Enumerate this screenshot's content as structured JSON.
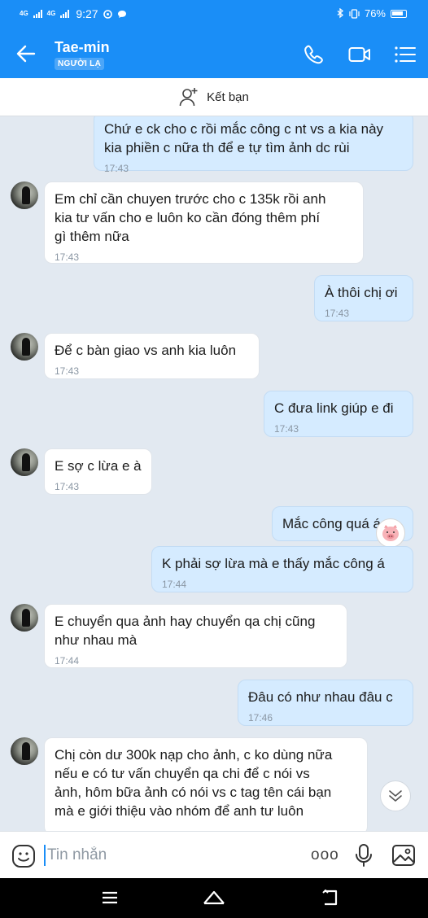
{
  "status_bar": {
    "net1": "4G",
    "net2": "4G",
    "time": "9:27",
    "battery": "76%"
  },
  "header": {
    "title": "Tae-min",
    "badge": "NGƯỜI LẠ",
    "accent": "#1a8ef7"
  },
  "friend_bar": {
    "label": "Kết bạn",
    "icon": "add-friend-icon"
  },
  "messages": [
    {
      "dir": "out",
      "text": "Chứ e ck cho c rồi mắc công c nt vs a kia này\nkia phiền c nữa th để e  tự tìm ảnh dc rùi",
      "time": "17:43"
    },
    {
      "dir": "in",
      "text": "Em chỉ cần chuyen trước cho c 135k rồi anh\nkia tư vấn cho e luôn ko cần đóng thêm phí\ngì thêm nữa",
      "time": "17:43"
    },
    {
      "dir": "out",
      "text": "À thôi chị ơi",
      "time": "17:43"
    },
    {
      "dir": "in",
      "text": "Để c bàn giao vs anh kia luôn",
      "time": "17:43"
    },
    {
      "dir": "out",
      "text": "C đưa link giúp e đi",
      "time": "17:43"
    },
    {
      "dir": "in",
      "text": "E sợ c lừa e à",
      "time": "17:43"
    },
    {
      "dir": "out",
      "text": "Mắc công quá á",
      "time": ""
    },
    {
      "dir": "out",
      "text": "K phải sợ lừa mà e thấy mắc công á",
      "time": "17:44"
    },
    {
      "dir": "in",
      "text": "E chuyển qua ảnh hay chuyển qa chị cũng\nnhư nhau mà",
      "time": "17:44"
    },
    {
      "dir": "out",
      "text": "Đâu có như nhau đâu c",
      "time": "17:46"
    },
    {
      "dir": "in",
      "text": "Chị còn dư 300k nạp cho ảnh, c ko dùng nữa\nnếu e có tư vấn chuyển qa chi để c nói vs\nảnh, hôm bữa ảnh có nói vs c tag tên cái bạn\nmà e giới thiệu vào nhóm để anh tư luôn",
      "time": ""
    }
  ],
  "composer": {
    "placeholder": "Tin nhắn",
    "more": "ooo"
  }
}
